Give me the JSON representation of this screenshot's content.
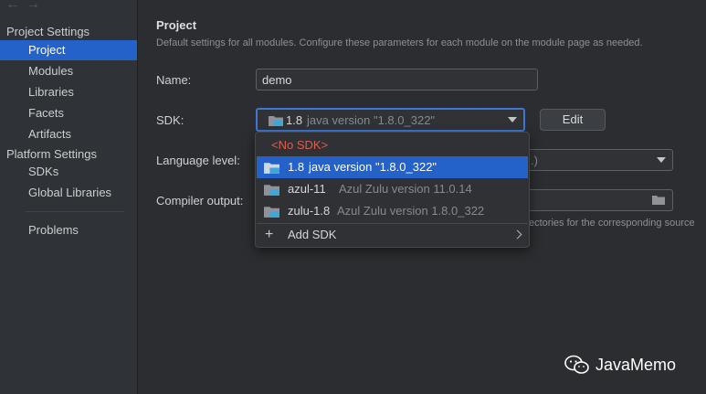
{
  "nav": {
    "back": "←",
    "forward": "→"
  },
  "sidebar": {
    "group_project": "Project Settings",
    "project_items": [
      "Project",
      "Modules",
      "Libraries",
      "Facets",
      "Artifacts"
    ],
    "group_platform": "Platform Settings",
    "platform_items": [
      "SDKs",
      "Global Libraries"
    ],
    "problems": "Problems",
    "active": "Project"
  },
  "main": {
    "title": "Project",
    "description": "Default settings for all modules. Configure these parameters for each module on the module page as needed.",
    "name_label": "Name:",
    "name_value": "demo",
    "sdk_label": "SDK:",
    "sdk_selected_name": "1.8",
    "sdk_selected_detail": "java version \"1.8.0_322\"",
    "edit_button": "Edit",
    "language_label": "Language level:",
    "language_value_tail": ".)",
    "compiler_label": "Compiler output:",
    "hint_tail": "ectories for the corresponding source"
  },
  "dropdown": {
    "no_sdk": "<No SDK>",
    "items": [
      {
        "name": "1.8",
        "detail": "java version \"1.8.0_322\"",
        "selected": true
      },
      {
        "name": "azul-11",
        "detail": "Azul Zulu version 11.0.14",
        "selected": false
      },
      {
        "name": "zulu-1.8",
        "detail": "Azul Zulu version 1.8.0_322",
        "selected": false
      }
    ],
    "add_sdk": "Add SDK",
    "add_icon": "+"
  },
  "watermark": {
    "text": "JavaMemo",
    "icon": "wechat-icon"
  },
  "colors": {
    "accent": "#2461c9",
    "no_sdk": "#e05a4e",
    "sdk_icon": "#3fa7d8"
  }
}
